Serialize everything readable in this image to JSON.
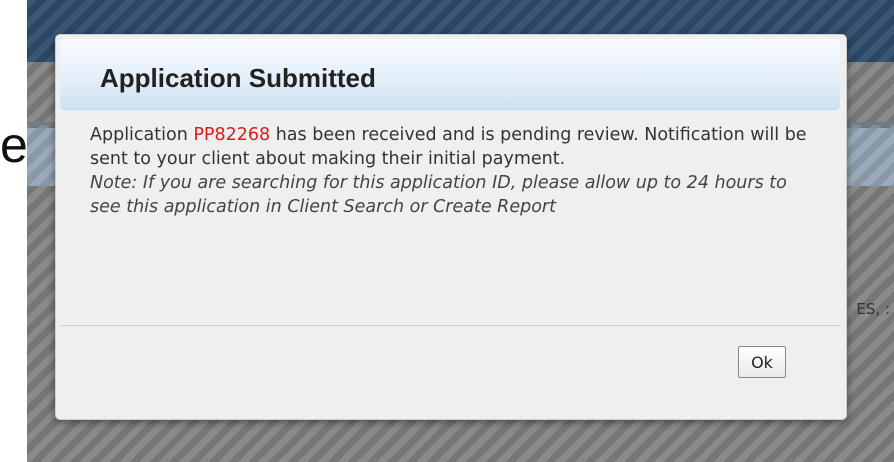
{
  "background": {
    "cropped_glyph": "e",
    "partial_text": "ES, :"
  },
  "dialog": {
    "title": "Application Submitted",
    "message_prefix": "Application",
    "application_id": "PP82268",
    "message_suffix": "has been received and is pending review. Notification will be sent to your client about making their initial payment.",
    "note": "Note: If you are searching for this application ID, please allow up to 24 hours to see this application in Client Search or Create Report",
    "ok_label": "Ok"
  },
  "colors": {
    "id_highlight": "#e01b1b",
    "header_bar": "#2f4c6b",
    "overlay": "#7d7d7d"
  }
}
